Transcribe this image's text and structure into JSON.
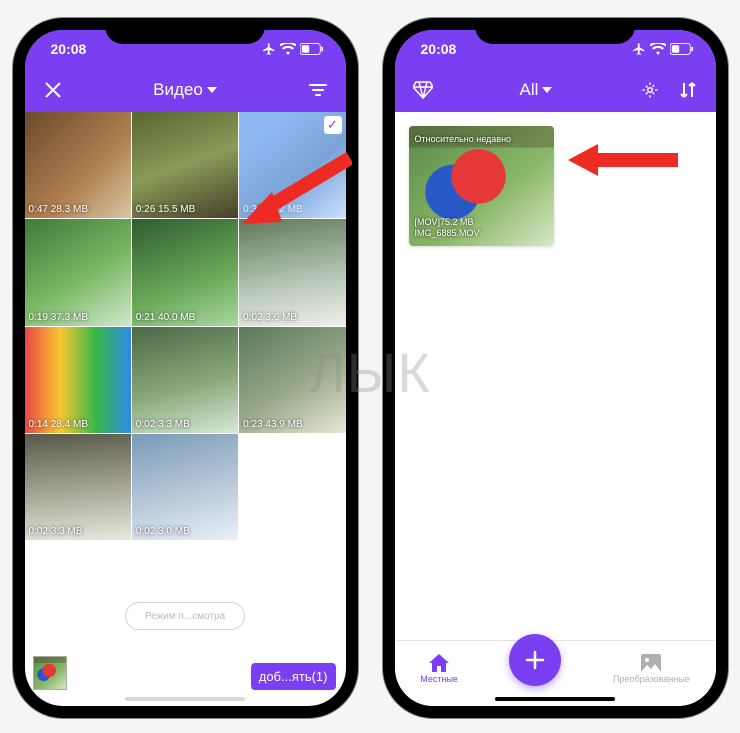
{
  "status": {
    "time": "20:08"
  },
  "left": {
    "title": "Видео",
    "hint": "Режим п...смотра",
    "add_label": "доб...ять(1)",
    "videos": [
      {
        "duration": "0:47",
        "size": "28.3 MB",
        "cls": "t-squirrel"
      },
      {
        "duration": "0:26",
        "size": "15.5 MB",
        "cls": "t-ostrich"
      },
      {
        "duration": "0:39",
        "size": "75.2 MB",
        "cls": "t-parrot",
        "selected": true
      },
      {
        "duration": "0:19",
        "size": "37.3 MB",
        "cls": "t-green1"
      },
      {
        "duration": "0:21",
        "size": "40.0 MB",
        "cls": "t-green2"
      },
      {
        "duration": "0:02",
        "size": "3.6 MB",
        "cls": "t-fall"
      },
      {
        "duration": "0:14",
        "size": "28.4 MB",
        "cls": "t-slide"
      },
      {
        "duration": "0:02",
        "size": "3.3 MB",
        "cls": "t-mtn"
      },
      {
        "duration": "0:23",
        "size": "43.9 MB",
        "cls": "t-river"
      },
      {
        "duration": "0:02",
        "size": "3.3 MB",
        "cls": "t-wfall"
      },
      {
        "duration": "0:02",
        "size": "3.0 MB",
        "cls": "t-rig"
      }
    ]
  },
  "right": {
    "title": "All",
    "card": {
      "tag": "Относительно недавно",
      "line1": "[MOV]75.2 MB",
      "line2": "IMG_6885.MOV"
    },
    "tabs": {
      "local": "Местные",
      "converted": "Преобразованные"
    }
  },
  "watermark": "ЛЫК"
}
